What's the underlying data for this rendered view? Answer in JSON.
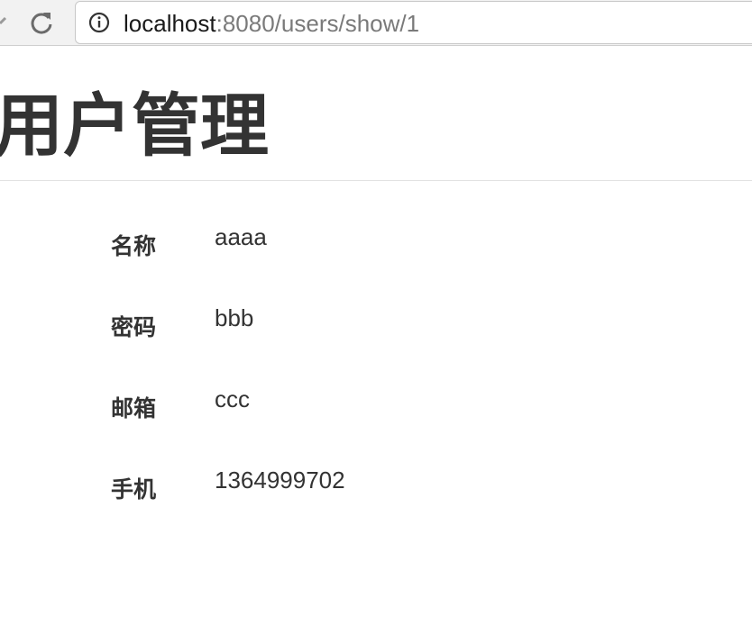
{
  "browser": {
    "url_host": "localhost",
    "url_rest": ":8080/users/show/1"
  },
  "page": {
    "title": "用户管理",
    "fields": [
      {
        "label": "名称",
        "value": "aaaa"
      },
      {
        "label": "密码",
        "value": "bbb"
      },
      {
        "label": "邮箱",
        "value": "ccc"
      },
      {
        "label": "手机",
        "value": "1364999702"
      }
    ]
  }
}
